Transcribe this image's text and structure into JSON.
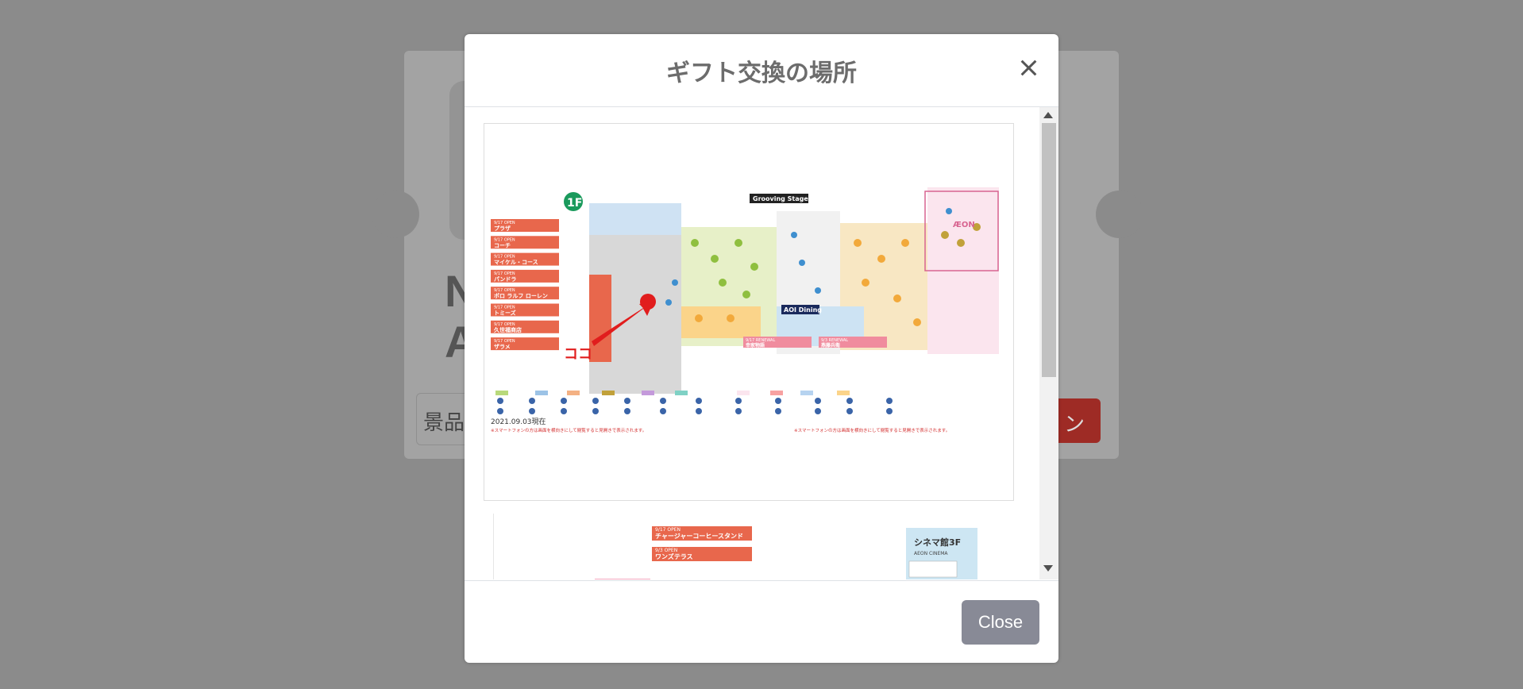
{
  "background": {
    "heading_line1": "N",
    "heading_line2": "A",
    "input_placeholder": "景品",
    "button_label": "ン"
  },
  "modal": {
    "title": "ギフト交換の場所",
    "close_button_label": "Close",
    "map": {
      "floor_label": "1F",
      "stage_label": "Grooving Stage",
      "dining_label": "AOI Dining",
      "marker_label": "ココ",
      "brand_label": "ÆON",
      "date_label": "2021.09.03現在",
      "footnote": "※スマートフォンの方は画面を横向きにして閲覧すると見開きで表示されます。",
      "shops": [
        {
          "open": "9/17 OPEN",
          "name": "プラザ"
        },
        {
          "open": "9/17 OPEN",
          "name": "コーチ"
        },
        {
          "open": "9/17 OPEN",
          "name": "マイケル・コース"
        },
        {
          "open": "9/17 OPEN",
          "name": "パンドラ"
        },
        {
          "open": "9/17 OPEN",
          "name": "ポロ ラルフ ローレン"
        },
        {
          "open": "9/17 OPEN",
          "name": "トミーズ"
        },
        {
          "open": "9/17 OPEN",
          "name": "久世福商店"
        },
        {
          "open": "9/17 OPEN",
          "name": "ザラメ"
        }
      ],
      "renewals": [
        {
          "label": "9/17 RENEWAL",
          "name": "幸家物語"
        },
        {
          "label": "9/3 RENEWAL",
          "name": "燕藤兵衛"
        }
      ],
      "second_map": {
        "shops": [
          {
            "open": "9/17 OPEN",
            "name": "チャージャーコーヒースタンド"
          },
          {
            "open": "9/3 OPEN",
            "name": "ワンズテラス"
          }
        ],
        "cinema_label": "シネマ館3F",
        "cinema_sub": "AEON CINEMA"
      }
    }
  },
  "colors": {
    "shop_red": "#e8674c",
    "marker_red": "#e11d1d",
    "close_button": "#888a96",
    "overlay": "#8b8b8b"
  }
}
